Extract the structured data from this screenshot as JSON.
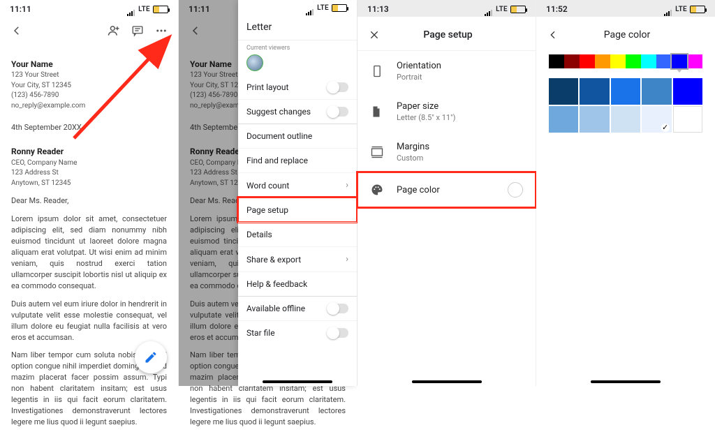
{
  "status": {
    "time1": "11:11",
    "time2": "11:11",
    "time3": "11:13",
    "time4": "11:52",
    "net": "LTE"
  },
  "doc": {
    "name": "Your Name",
    "addr1": "123 Your Street",
    "addr2": "Your City, ST 12345",
    "phone": "(123) 456-7890",
    "email": "no_reply@example.com",
    "date": "4th September 20XX",
    "reader_name": "Ronny Reader",
    "reader_title": "CEO, Company Name",
    "reader_addr1": "123 Address St",
    "reader_addr2": "Anytown, ST 12345",
    "salutation": "Dear Ms. Reader,",
    "p1": "Lorem ipsum dolor sit amet, consectetuer adipiscing elit, sed diam nonummy nibh euismod tincidunt ut laoreet dolore magna aliquam erat volutpat. Ut wisi enim ad minim veniam, quis nostrud exerci tation ullamcorper suscipit lobortis nisl ut aliquip ex ea commodo consequat.",
    "p2": "Duis autem vel eum iriure dolor in hendrerit in vulputate velit esse molestie consequat, vel illum dolore eu feugiat nulla facilisis at vero eros et accumsan.",
    "p3": "Nam liber tempor cum soluta nobis eleifend option congue nihil imperdiet doming id quod mazim placerat facer possim assum. Typi non habent claritatem insitam; est usus legentis in iis qui facit eorum claritatem. Investigationes demonstraverunt lectores legere me lius quod ii legunt saepius."
  },
  "menu": {
    "doc_title": "Letter",
    "viewers_label": "Current viewers",
    "print_layout": "Print layout",
    "suggest": "Suggest changes",
    "outline": "Document outline",
    "find": "Find and replace",
    "wordcount": "Word count",
    "pagesetup": "Page setup",
    "details": "Details",
    "share": "Share & export",
    "help": "Help & feedback",
    "offline": "Available offline",
    "star": "Star file"
  },
  "pagesetup": {
    "title": "Page setup",
    "orientation": "Orientation",
    "orientation_val": "Portrait",
    "papersize": "Paper size",
    "papersize_val": "Letter (8.5\" x 11\")",
    "margins": "Margins",
    "margins_val": "Custom",
    "pagecolor": "Page color"
  },
  "pagecolor": {
    "title": "Page color",
    "strip": [
      "#000000",
      "#8b0000",
      "#ff0000",
      "#ff9900",
      "#ffff00",
      "#00ff00",
      "#00ffff",
      "#3366ff",
      "#0000ff",
      "#ff00ff"
    ],
    "selected_strip": 8,
    "shades": [
      "#0b3d6b",
      "#1155a0",
      "#1a73e8",
      "#3d85c6",
      "#0000ff",
      "#6fa8dc",
      "#9fc5e8",
      "#cfe2f3",
      "#e8f0fe",
      "#ffffff"
    ],
    "selected_shade": 8
  }
}
